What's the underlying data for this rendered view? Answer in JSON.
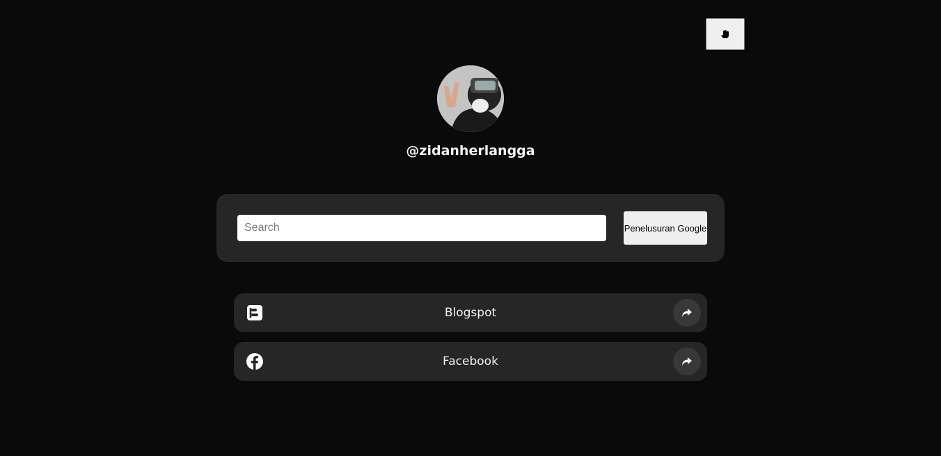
{
  "profile": {
    "username": "@zidanherlangga"
  },
  "search": {
    "placeholder": "Search",
    "value": "",
    "button_label": "Penelusuran Google"
  },
  "links": [
    {
      "label": "Blogspot",
      "icon": "blogger-icon"
    },
    {
      "label": "Facebook",
      "icon": "facebook-icon"
    }
  ],
  "toolbar": {
    "icon": "hand-icon"
  }
}
